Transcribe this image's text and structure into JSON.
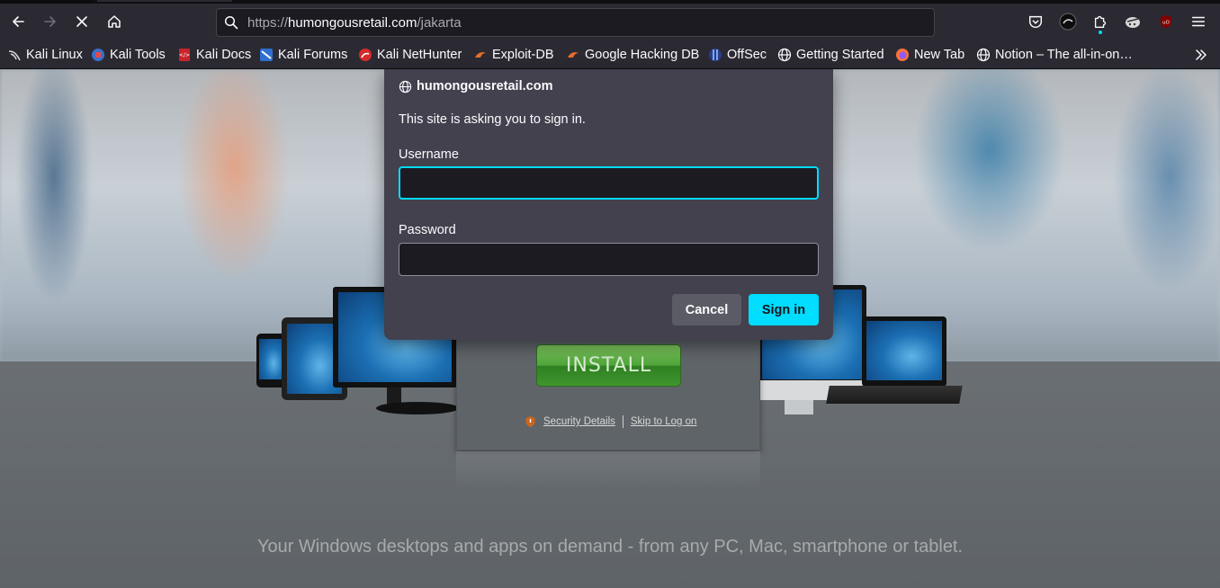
{
  "browser": {
    "url_prefix": "https://",
    "url_host": "humongousretail.com",
    "url_path": "/jakarta"
  },
  "bookmarks": [
    {
      "label": "Kali Linux",
      "icon": "kali-dragon-icon"
    },
    {
      "label": "Kali Tools",
      "icon": "kali-tools-icon"
    },
    {
      "label": "Kali Docs",
      "icon": "kali-docs-icon"
    },
    {
      "label": "Kali Forums",
      "icon": "kali-forums-icon"
    },
    {
      "label": "Kali NetHunter",
      "icon": "nethunter-icon"
    },
    {
      "label": "Exploit-DB",
      "icon": "exploit-db-icon"
    },
    {
      "label": "Google Hacking DB",
      "icon": "ghdb-icon"
    },
    {
      "label": "OffSec",
      "icon": "offsec-icon"
    },
    {
      "label": "Getting Started",
      "icon": "globe-icon"
    },
    {
      "label": "New Tab",
      "icon": "firefox-icon"
    },
    {
      "label": "Notion – The all-in-on…",
      "icon": "globe-icon"
    }
  ],
  "dialog": {
    "host": "humongousretail.com",
    "message": "This site is asking you to sign in.",
    "username_label": "Username",
    "username_value": "",
    "password_label": "Password",
    "password_value": "",
    "cancel_label": "Cancel",
    "signin_label": "Sign in"
  },
  "page": {
    "install_label": "INSTALL",
    "security_details": "Security Details",
    "skip_logon": "Skip to Log on",
    "tagline": "Your Windows desktops and apps on demand - from any PC, Mac, smartphone or tablet."
  },
  "colors": {
    "accent": "#00ddff",
    "toolbar": "#2b2a33",
    "dialog_bg": "#42414d"
  }
}
